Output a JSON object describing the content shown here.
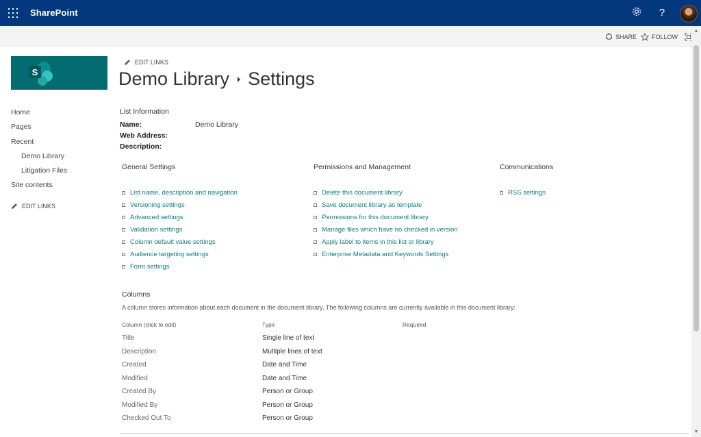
{
  "suite": {
    "brand": "SharePoint",
    "icons": [
      "app-launcher-icon",
      "gear-icon",
      "help-icon",
      "avatar"
    ]
  },
  "actions": {
    "share": "SHARE",
    "follow": "FOLLOW"
  },
  "nav": {
    "items": [
      {
        "label": "Home",
        "sub": false
      },
      {
        "label": "Pages",
        "sub": false
      },
      {
        "label": "Recent",
        "sub": false
      },
      {
        "label": "Demo Library",
        "sub": true
      },
      {
        "label": "Litigation Files",
        "sub": true
      },
      {
        "label": "Site contents",
        "sub": false
      }
    ],
    "edit_links": "EDIT LINKS"
  },
  "top_edit_links": "EDIT LINKS",
  "title": {
    "library": "Demo Library",
    "page": "Settings"
  },
  "list_info": {
    "heading": "List Information",
    "name_label": "Name:",
    "name_value": "Demo Library",
    "web_address_label": "Web Address:",
    "description_label": "Description:"
  },
  "general": {
    "heading": "General Settings",
    "links": [
      "List name, description and navigation",
      "Versioning settings",
      "Advanced settings",
      "Validation settings",
      "Column default value settings",
      "Audience targeting settings",
      "Form settings"
    ]
  },
  "permissions": {
    "heading": "Permissions and Management",
    "links": [
      "Delete this document library",
      "Save document library as template",
      "Permissions for this document library",
      "Manage files which have no checked in version",
      "Apply label to items in this list or library",
      "Enterprise Metadata and Keywords Settings"
    ]
  },
  "communications": {
    "heading": "Communications",
    "links": [
      "RSS settings"
    ]
  },
  "columns": {
    "heading": "Columns",
    "description": "A column stores information about each document in the document library. The following columns are currently available in this document library:",
    "headers": {
      "name": "Column (click to edit)",
      "type": "Type",
      "required": "Required"
    },
    "rows": [
      {
        "name": "Title",
        "type": "Single line of text"
      },
      {
        "name": "Description",
        "type": "Multiple lines of text"
      },
      {
        "name": "Created",
        "type": "Date and Time"
      },
      {
        "name": "Modified",
        "type": "Date and Time"
      },
      {
        "name": "Created By",
        "type": "Person or Group"
      },
      {
        "name": "Modified By",
        "type": "Person or Group"
      },
      {
        "name": "Checked Out To",
        "type": "Person or Group"
      }
    ]
  },
  "colors": {
    "suite_bar": "#03387f",
    "link": "#0f7c7f",
    "logo_tile": "#036c70"
  }
}
